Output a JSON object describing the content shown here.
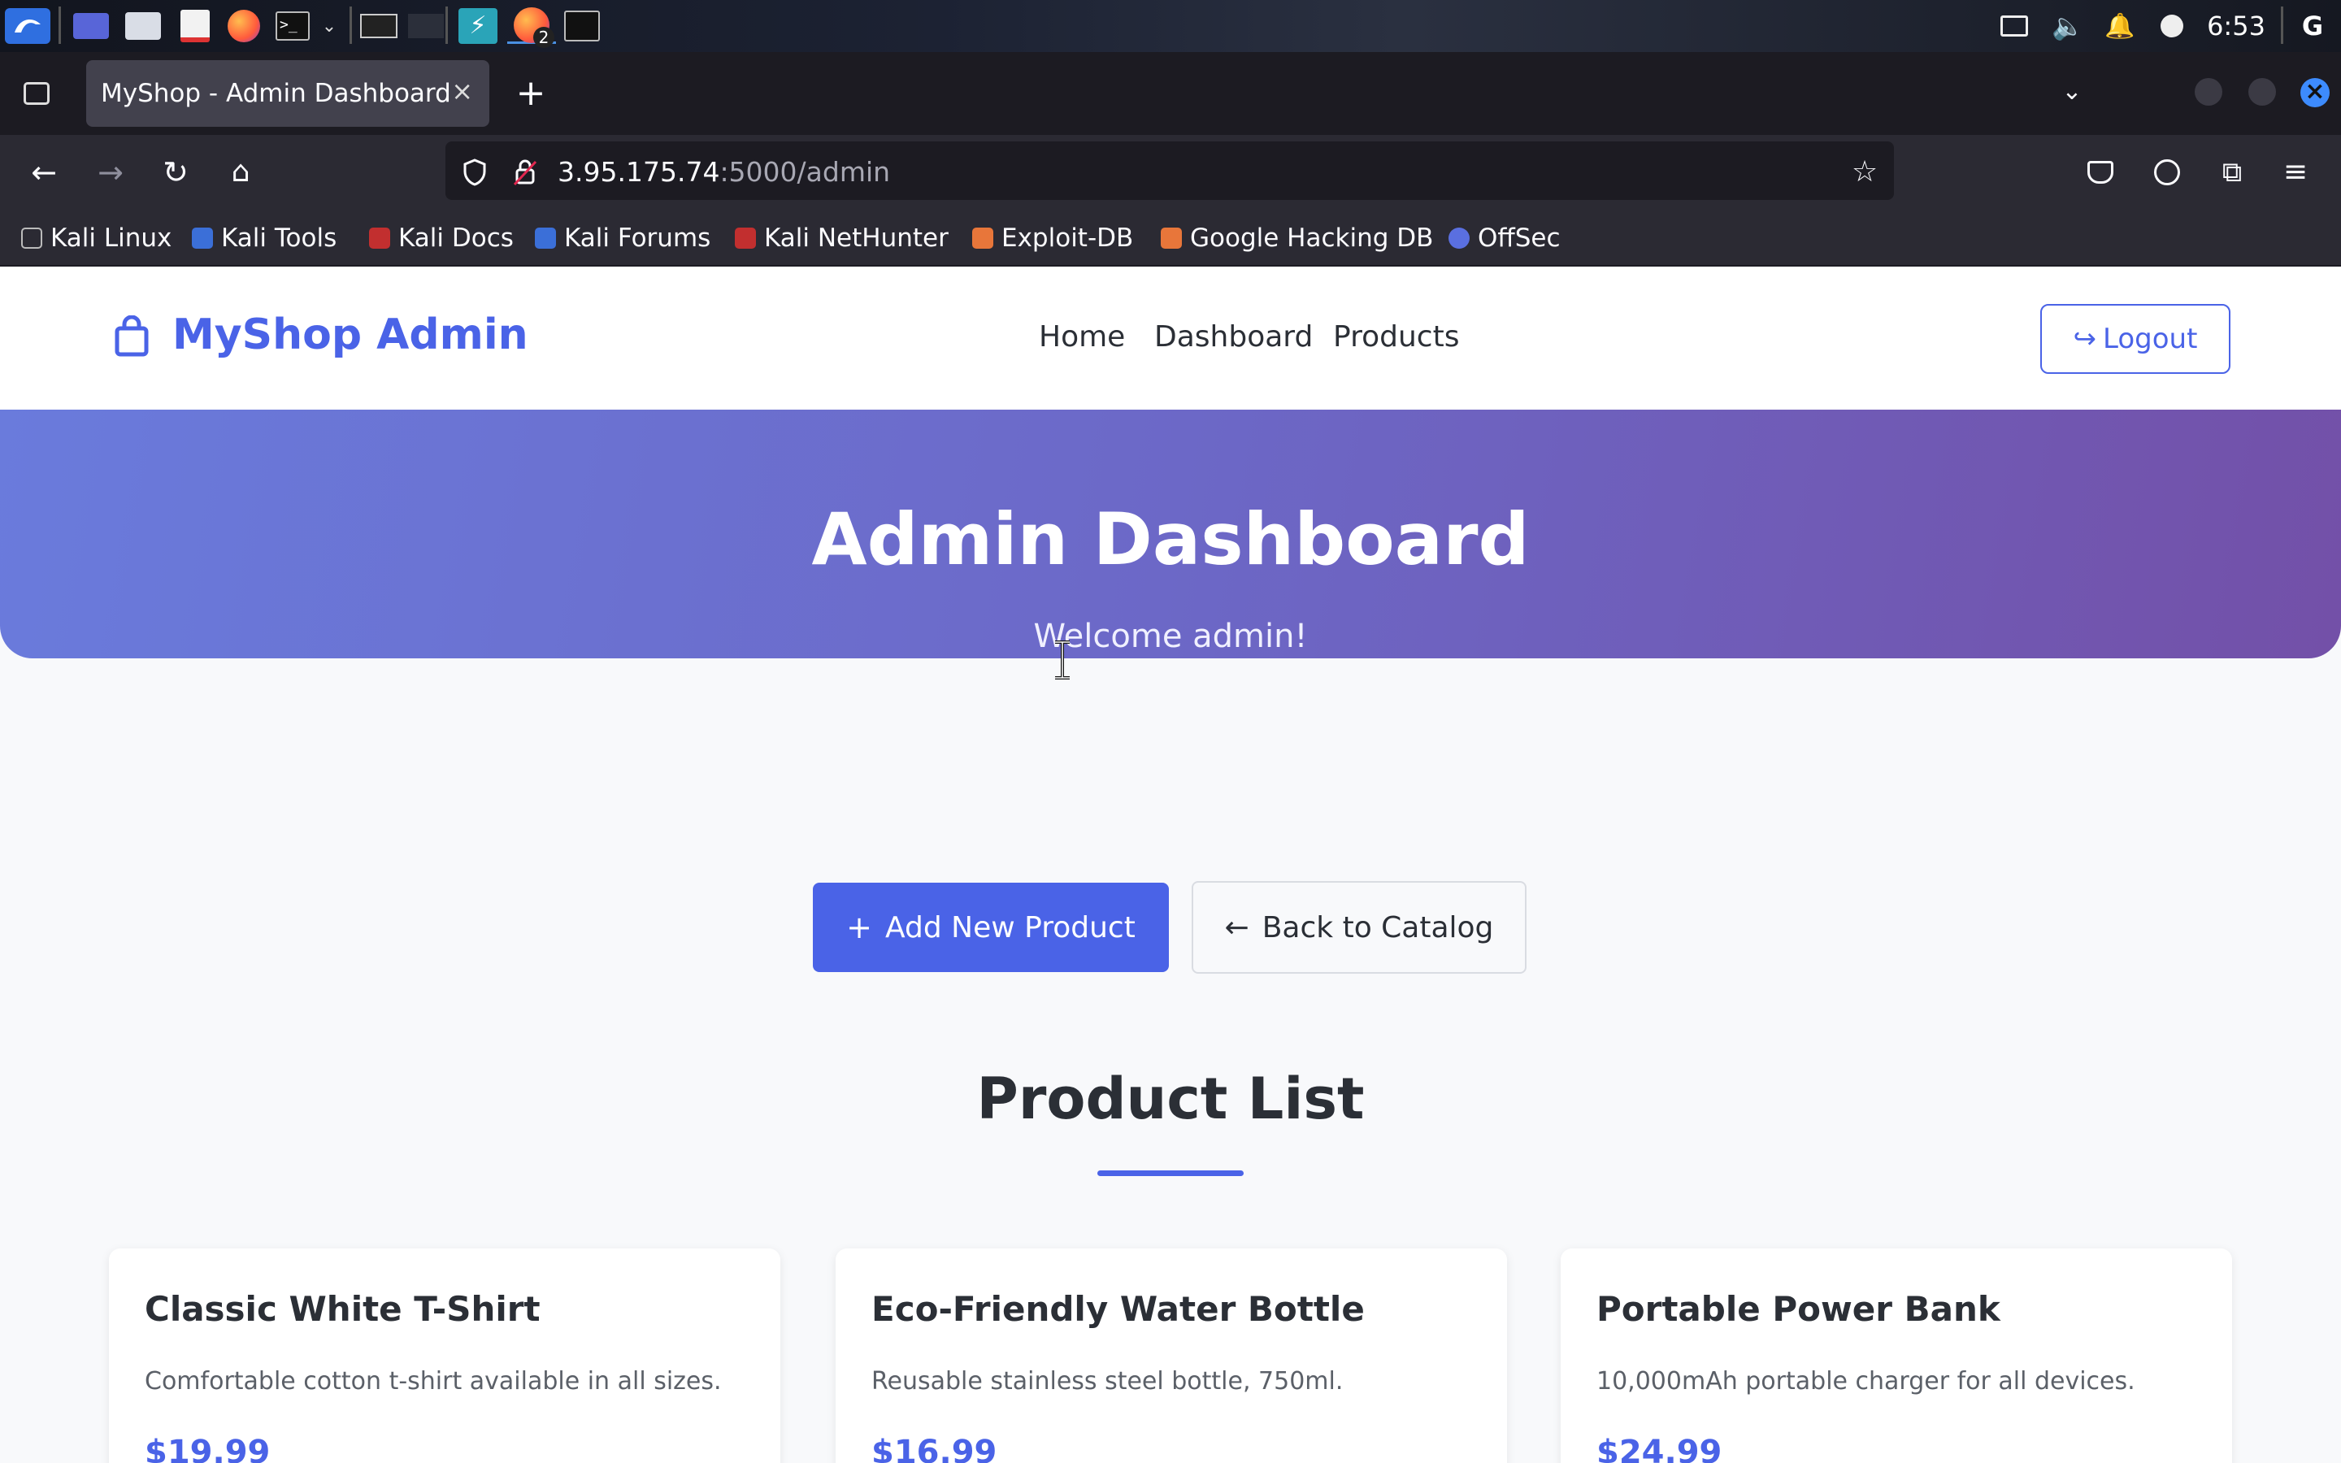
{
  "system_panel": {
    "clock": "6:53",
    "firefox_badge": "2"
  },
  "browser": {
    "tab_title": "MyShop - Admin Dashboard",
    "url_host": "3.95.175.74",
    "url_path": ":5000/admin",
    "bookmarks": [
      {
        "label": "Kali Linux",
        "color": "#3a3a3a"
      },
      {
        "label": "Kali Tools",
        "color": "#3b6fd8"
      },
      {
        "label": "Kali Docs",
        "color": "#c22f2f"
      },
      {
        "label": "Kali Forums",
        "color": "#3b6fd8"
      },
      {
        "label": "Kali NetHunter",
        "color": "#c22f2f"
      },
      {
        "label": "Exploit-DB",
        "color": "#e8763a"
      },
      {
        "label": "Google Hacking DB",
        "color": "#e8763a"
      },
      {
        "label": "OffSec",
        "color": "#5a6fe0"
      }
    ]
  },
  "site": {
    "brand": "MyShop Admin",
    "nav": [
      "Home",
      "Dashboard",
      "Products"
    ],
    "logout_label": "Logout",
    "hero_title": "Admin Dashboard",
    "hero_subtitle": "Welcome admin!",
    "add_button_label": "Add New Product",
    "back_button_label": "Back to Catalog",
    "section_title": "Product List",
    "accent_color": "#4a63e7",
    "products": [
      {
        "name": "Classic White T-Shirt",
        "description": "Comfortable cotton t-shirt available in all sizes.",
        "price": "$19.99"
      },
      {
        "name": "Eco-Friendly Water Bottle",
        "description": "Reusable stainless steel bottle, 750ml.",
        "price": "$16.99"
      },
      {
        "name": "Portable Power Bank",
        "description": "10,000mAh portable charger for all devices.",
        "price": "$24.99"
      }
    ]
  }
}
